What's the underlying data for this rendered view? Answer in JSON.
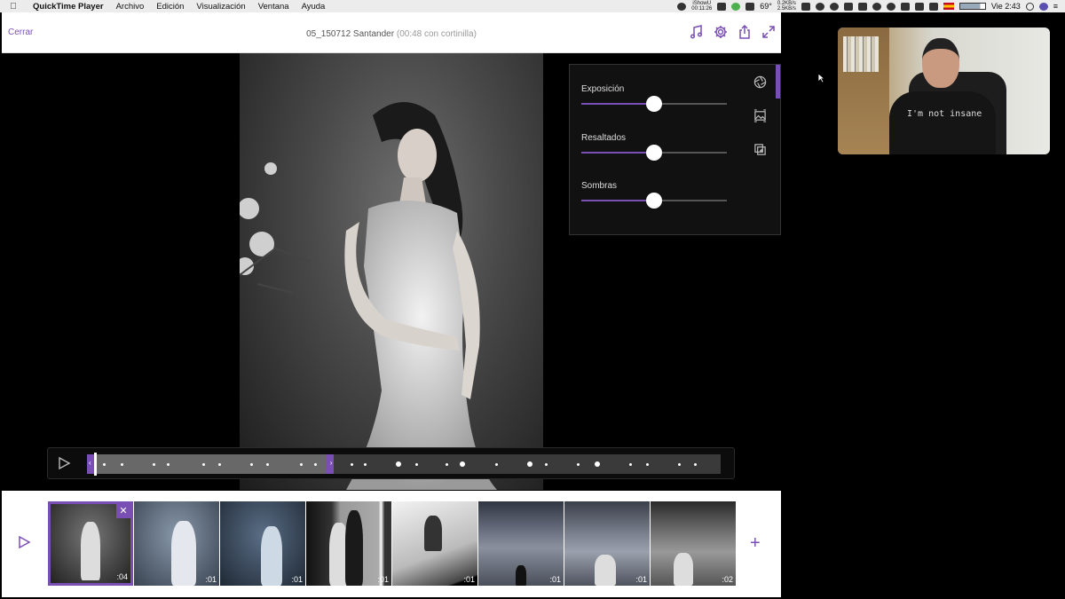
{
  "menubar": {
    "apple_icon": "apple-logo",
    "app_name": "QuickTime Player",
    "menus": [
      "Archivo",
      "Edición",
      "Visualización",
      "Ventana",
      "Ayuda"
    ],
    "ishowu_line1": "iShowU",
    "ishowu_line2": "00:11:26",
    "temperature": "69°",
    "net_up": "0.2KB/s",
    "net_down": "2.5KB/s",
    "clock": "Vie 2:43"
  },
  "app": {
    "close_label": "Cerrar",
    "title": "05_150712 Santander",
    "title_sub": "(00:48 con cortinilla)",
    "accent_color": "#7a4fb5",
    "top_icons": [
      "music-note-icon",
      "gear-icon",
      "share-icon",
      "expand-icon"
    ]
  },
  "adjust": {
    "sliders": [
      {
        "label": "Exposición",
        "value": 0.5
      },
      {
        "label": "Resaltados",
        "value": 0.5
      },
      {
        "label": "Sombras",
        "value": 0.5
      }
    ],
    "side_icons": [
      "aperture-icon",
      "image-frame-icon",
      "copy-icon"
    ]
  },
  "scrubber": {
    "selection_start": 0.0,
    "selection_end": 0.39,
    "playhead": 0.0
  },
  "filmstrip": {
    "clips": [
      {
        "duration": ":04",
        "selected": true
      },
      {
        "duration": ":01",
        "selected": false
      },
      {
        "duration": ":01",
        "selected": false
      },
      {
        "duration": ":01",
        "selected": false
      },
      {
        "duration": ":01",
        "selected": false
      },
      {
        "duration": ":01",
        "selected": false
      },
      {
        "duration": ":01",
        "selected": false
      },
      {
        "duration": ":02",
        "selected": false
      }
    ],
    "remove_icon": "✕",
    "add_icon": "+"
  },
  "webcam": {
    "shirt_text": "I'm not insane"
  }
}
